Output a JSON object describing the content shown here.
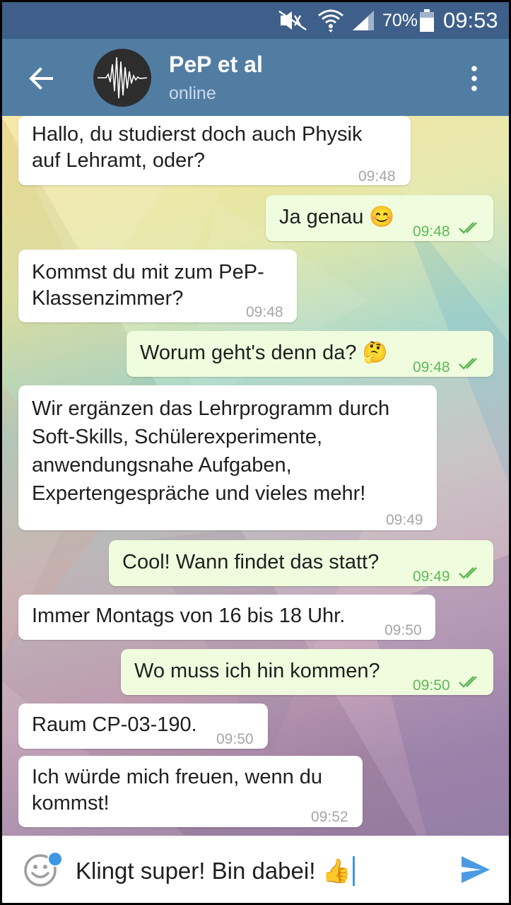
{
  "status_bar": {
    "battery_percent": "70%",
    "time": "09:53",
    "icons": [
      "mute-icon",
      "wifi-icon",
      "signal-icon",
      "battery-icon"
    ]
  },
  "header": {
    "title": "PeP et al",
    "subtitle": "online",
    "icons": [
      "back-arrow-icon",
      "menu-dots-icon"
    ]
  },
  "messages": [
    {
      "dir": "in",
      "lines": "Hallo, du studierst doch auch Physik\nauf Lehramt, oder?",
      "time": "09:48"
    },
    {
      "dir": "out",
      "lines": "Ja genau 😊",
      "time": "09:48",
      "read": true
    },
    {
      "dir": "in",
      "lines": "Kommst du mit zum PeP-\nKlassenzimmer?",
      "time": "09:48"
    },
    {
      "dir": "out",
      "lines": "Worum geht's denn da? 🤔",
      "time": "09:48",
      "read": true
    },
    {
      "dir": "in",
      "lines": "Wir ergänzen das Lehrprogramm durch\nSoft-Skills, Schülerexperimente,\nanwendungsnahe Aufgaben,\nExpertengespräche und vieles mehr!",
      "time": "09:49"
    },
    {
      "dir": "out",
      "lines": "Cool! Wann findet das statt?",
      "time": "09:49",
      "read": true
    },
    {
      "dir": "in",
      "lines": "Immer Montags von 16 bis 18 Uhr.",
      "time": "09:50"
    },
    {
      "dir": "out",
      "lines": "Wo muss ich hin kommen?",
      "time": "09:50",
      "read": true
    },
    {
      "dir": "in",
      "lines": "Raum CP-03-190.",
      "time": "09:50"
    },
    {
      "dir": "in",
      "lines": "Ich würde mich freuen, wenn du\nkommst!",
      "time": "09:52"
    }
  ],
  "composer": {
    "text": "Klingt super! Bin dabei! 👍",
    "icons": [
      "emoji-icon",
      "send-icon"
    ]
  },
  "colors": {
    "status_bar": "#3d5f89",
    "header": "#527da3",
    "incoming_bubble": "#ffffff",
    "outgoing_bubble": "#effdde",
    "outgoing_time": "#5fb757",
    "accent": "#3e97e3"
  }
}
